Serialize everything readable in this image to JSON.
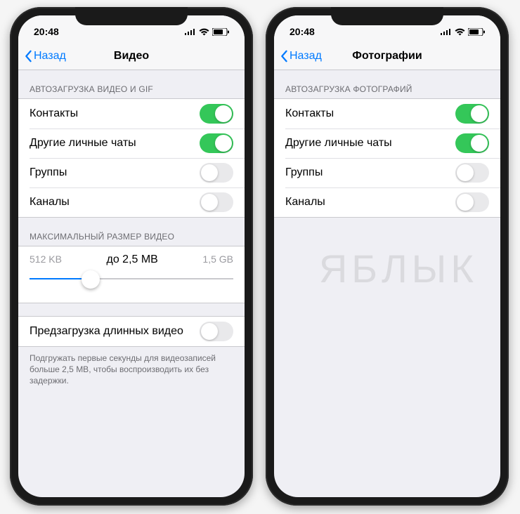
{
  "watermark": "ЯБЛЫК",
  "statusbar": {
    "time": "20:48"
  },
  "phone1": {
    "nav": {
      "back": "Назад",
      "title": "Видео"
    },
    "section1_header": "АВТОЗАГРУЗКА ВИДЕО И GIF",
    "rows": [
      {
        "label": "Контакты",
        "on": true
      },
      {
        "label": "Другие личные чаты",
        "on": true
      },
      {
        "label": "Группы",
        "on": false
      },
      {
        "label": "Каналы",
        "on": false
      }
    ],
    "section2_header": "МАКСИМАЛЬНЫЙ РАЗМЕР ВИДЕО",
    "slider": {
      "min_label": "512 KB",
      "value_label": "до 2,5 MB",
      "max_label": "1,5 GB",
      "pct": 30
    },
    "preload": {
      "label": "Предзагрузка длинных видео",
      "on": false
    },
    "footer": "Подгружать первые секунды для видеозаписей больше 2,5 MB, чтобы воспроизводить их без задержки."
  },
  "phone2": {
    "nav": {
      "back": "Назад",
      "title": "Фотографии"
    },
    "section1_header": "АВТОЗАГРУЗКА ФОТОГРАФИЙ",
    "rows": [
      {
        "label": "Контакты",
        "on": true
      },
      {
        "label": "Другие личные чаты",
        "on": true
      },
      {
        "label": "Группы",
        "on": false
      },
      {
        "label": "Каналы",
        "on": false
      }
    ]
  }
}
